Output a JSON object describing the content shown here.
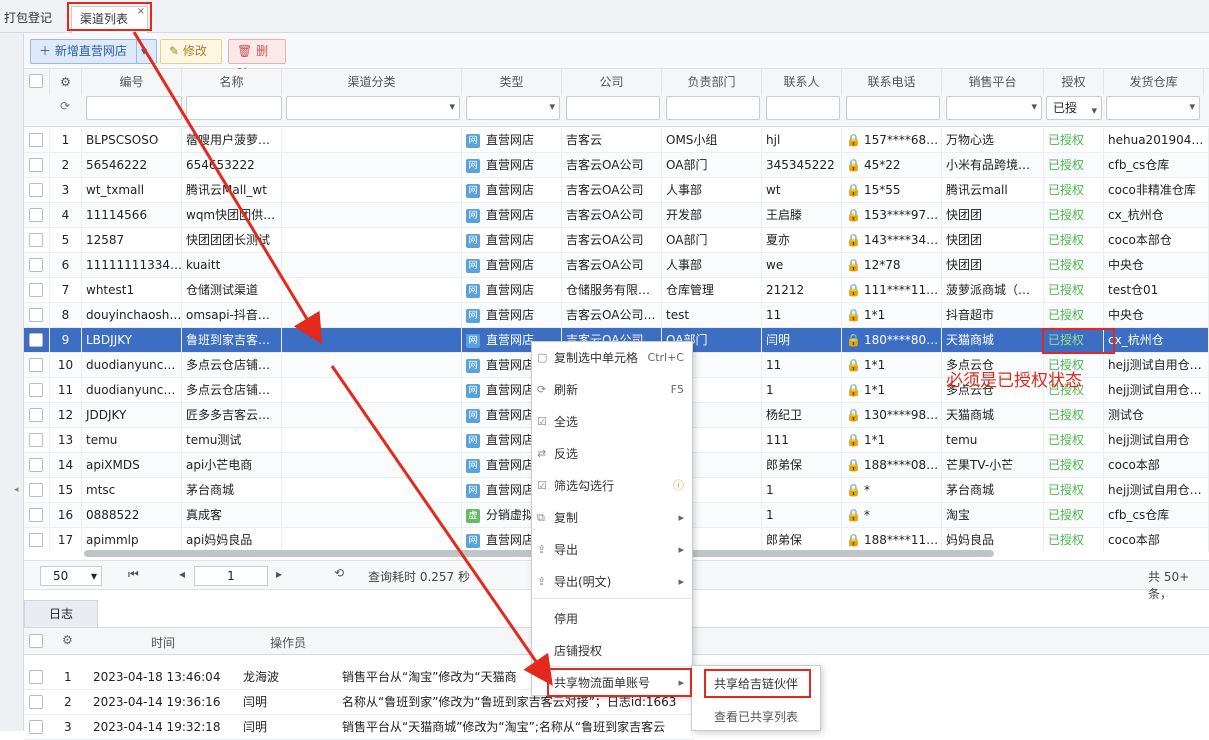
{
  "tabs": [
    {
      "label": "打包登记"
    },
    {
      "label": "渠道列表"
    }
  ],
  "toolbar": {
    "add": "新增直营网店",
    "edit": "修改",
    "delete": "删除"
  },
  "columns": [
    "编号",
    "名称",
    "渠道分类",
    "类型",
    "公司",
    "负责部门",
    "联系人",
    "联系电话",
    "销售平台",
    "授权",
    "发货仓库"
  ],
  "filter_auth_value": "已授",
  "rows": [
    {
      "n": "1",
      "code": "BLPSCSOSO",
      "name": "蓿嗖用户菠萝…",
      "type": "直营网店",
      "company": "吉客云",
      "dept": "OMS小组",
      "contact": "hjl",
      "phone": "157****68…",
      "platform": "万物心选",
      "auth": "已授权",
      "warehouse": "hehua201904…"
    },
    {
      "n": "2",
      "code": "56546222",
      "name": "654653222",
      "type": "直营网店",
      "company": "吉客云OA公司",
      "dept": "OA部门",
      "contact": "345345222",
      "phone": "45*22",
      "platform": "小米有品跨境…",
      "auth": "已授权",
      "warehouse": "cfb_cs仓库"
    },
    {
      "n": "3",
      "code": "wt_txmall",
      "name": "腾讯云Mall_wt",
      "type": "直营网店",
      "company": "吉客云OA公司",
      "dept": "人事部",
      "contact": "wt",
      "phone": "15*55",
      "platform": "腾讯云mall",
      "auth": "已授权",
      "warehouse": "coco非精准仓库"
    },
    {
      "n": "4",
      "code": "11114566",
      "name": "wqm快团团供…",
      "type": "直营网店",
      "company": "吉客云OA公司",
      "dept": "开发部",
      "contact": "王启滕",
      "phone": "153****97…",
      "platform": "快团团",
      "auth": "已授权",
      "warehouse": "cx_杭州仓"
    },
    {
      "n": "5",
      "code": "12587",
      "name": "快团团团长测试",
      "type": "直营网店",
      "company": "吉客云OA公司",
      "dept": "OA部门",
      "contact": "夏亦",
      "phone": "143****34…",
      "platform": "快团团",
      "auth": "已授权",
      "warehouse": "coco本部仓"
    },
    {
      "n": "6",
      "code": "11111111334…",
      "name": "kuaitt",
      "type": "直营网店",
      "company": "吉客云OA公司",
      "dept": "人事部",
      "contact": "we",
      "phone": "12*78",
      "platform": "快团团",
      "auth": "已授权",
      "warehouse": "中央仓"
    },
    {
      "n": "7",
      "code": "whtest1",
      "name": "仓储测试渠道",
      "type": "直营网店",
      "company": "仓储服务有限…",
      "dept": "仓库管理",
      "contact": "21212",
      "phone": "111****11…",
      "platform": "菠萝派商城（…",
      "auth": "已授权",
      "warehouse": "test仓01"
    },
    {
      "n": "8",
      "code": "douyinchaosh…",
      "name": "omsapi-抖音…",
      "type": "直营网店",
      "company": "吉客云OA公司…",
      "dept": "test",
      "contact": "11",
      "phone": "1*1",
      "platform": "抖音超市",
      "auth": "已授权",
      "warehouse": "中央仓"
    },
    {
      "n": "9",
      "code": "LBDJJKY",
      "name": "鲁班到家吉客…",
      "type": "直营网店",
      "company": "吉客云OA公司",
      "dept": "OA部门",
      "contact": "闫明",
      "phone": "180****80…",
      "platform": "天猫商城",
      "auth": "已授权",
      "warehouse": "cx_杭州仓"
    },
    {
      "n": "10",
      "code": "duodianyunc…",
      "name": "多点云仓店铺…",
      "type": "直营网店",
      "company": "",
      "dept": "部",
      "contact": "11",
      "phone": "1*1",
      "platform": "多点云仓",
      "auth": "已授权",
      "warehouse": "hejj测试自用仓…"
    },
    {
      "n": "11",
      "code": "duodianyunc…",
      "name": "多点云仓店铺…",
      "type": "直营网店",
      "company": "",
      "dept": "部",
      "contact": "1",
      "phone": "1*1",
      "platform": "多点云仓",
      "auth": "已授权",
      "warehouse": "hejj测试自用仓…"
    },
    {
      "n": "12",
      "code": "JDDJKY",
      "name": "匠多多吉客云…",
      "type": "直营网店",
      "company": "",
      "dept": "部",
      "contact": "杨纪卫",
      "phone": "130****98…",
      "platform": "天猫商城",
      "auth": "已授权",
      "warehouse": "测试仓"
    },
    {
      "n": "13",
      "code": "temu",
      "name": "temu测试",
      "type": "直营网店",
      "company": "",
      "dept": "部",
      "contact": "111",
      "phone": "1*1",
      "platform": "temu",
      "auth": "已授权",
      "warehouse": "hejj测试自用仓"
    },
    {
      "n": "14",
      "code": "apiXMDS",
      "name": "api小芒电商",
      "type": "直营网店",
      "company": "",
      "dept": "部门",
      "contact": "郎弟保",
      "phone": "188****08…",
      "platform": "芒果TV-小芒",
      "auth": "已授权",
      "warehouse": "coco本部"
    },
    {
      "n": "15",
      "code": "mtsc",
      "name": "茅台商城",
      "type": "直营网店",
      "company": "",
      "dept": "部",
      "contact": "1",
      "phone": "*",
      "platform": "茅台商城",
      "auth": "已授权",
      "warehouse": "hejj测试自用仓…"
    },
    {
      "n": "16",
      "code": "0888522",
      "name": "真成客",
      "type": "分销虚拟",
      "company": "",
      "dept": "",
      "contact": "1",
      "phone": "*",
      "platform": "淘宝",
      "auth": "已授权",
      "warehouse": "cfb_cs仓库"
    },
    {
      "n": "17",
      "code": "apimmlp",
      "name": "api妈妈良品",
      "type": "直营网店",
      "company": "",
      "dept": "",
      "contact": "郎弟保",
      "phone": "188****11…",
      "platform": "妈妈良品",
      "auth": "已授权",
      "warehouse": "coco本部"
    }
  ],
  "pager": {
    "size": "50",
    "page": "1",
    "query_time": "查询耗时 0.257 秒",
    "total": "共 50+ 条，"
  },
  "log": {
    "tab": "日志",
    "columns": [
      "时间",
      "操作员"
    ],
    "rows": [
      {
        "n": "1",
        "time": "2023-04-18 13:46:04",
        "op": "龙海波",
        "msg": "销售平台从“淘宝”修改为“天猫商"
      },
      {
        "n": "2",
        "time": "2023-04-14 19:36:16",
        "op": "闫明",
        "msg": "名称从“鲁班到家”修改为“鲁班到家吉客云对接”；日志id:1663"
      },
      {
        "n": "3",
        "time": "2023-04-14 19:32:18",
        "op": "闫明",
        "msg": "销售平台从“天猫商城”修改为“淘宝”;名称从“鲁班到家吉客云"
      }
    ]
  },
  "context_menu": [
    {
      "label": "复制选中单元格",
      "shortcut": "Ctrl+C",
      "icon": "copy-cell-icon"
    },
    {
      "label": "刷新",
      "shortcut": "F5",
      "icon": "refresh-icon"
    },
    {
      "label": "全选",
      "shortcut": "",
      "icon": "select-all-icon"
    },
    {
      "label": "反选",
      "shortcut": "",
      "icon": "invert-select-icon"
    },
    {
      "label": "筛选勾选行",
      "shortcut": "",
      "icon": "filter-icon"
    },
    {
      "label": "复制",
      "shortcut": "",
      "icon": "copy-icon"
    },
    {
      "label": "导出",
      "shortcut": "",
      "icon": "export-icon"
    },
    {
      "label": "导出(明文)",
      "shortcut": "",
      "icon": "export-plain-icon"
    },
    {
      "label": "停用",
      "shortcut": "",
      "icon": ""
    },
    {
      "label": "店铺授权",
      "shortcut": "",
      "icon": ""
    },
    {
      "label": "共享物流面单账号",
      "shortcut": "",
      "icon": ""
    }
  ],
  "submenu": [
    "共享给吉链伙伴",
    "查看已共享列表"
  ],
  "annotation": "必须是已授权状态",
  "colors": {
    "selected_row": "#3c6fc4",
    "annotation": "#e3291c",
    "authorized": "#4cb84c"
  }
}
